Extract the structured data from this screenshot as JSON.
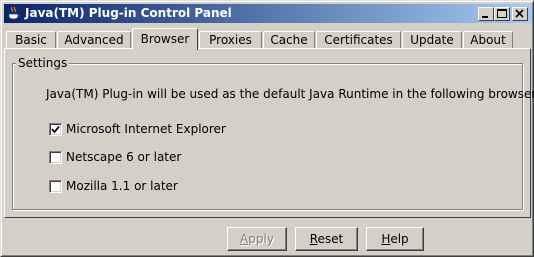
{
  "window": {
    "title": "Java(TM) Plug-in Control Panel",
    "icon": "java-coffee-cup-icon",
    "controls": [
      "minimize-icon",
      "maximize-icon",
      "close-icon"
    ]
  },
  "tabs": [
    {
      "label": "Basic",
      "active": false
    },
    {
      "label": "Advanced",
      "active": false
    },
    {
      "label": "Browser",
      "active": true
    },
    {
      "label": "Proxies",
      "active": false
    },
    {
      "label": "Cache",
      "active": false
    },
    {
      "label": "Certificates",
      "active": false
    },
    {
      "label": "Update",
      "active": false
    },
    {
      "label": "About",
      "active": false
    }
  ],
  "settings": {
    "group_label": "Settings",
    "message": "Java(TM) Plug-in will be used as the default Java Runtime in the following browser(s):",
    "options": [
      {
        "label": "Microsoft Internet Explorer",
        "checked": true
      },
      {
        "label": "Netscape 6 or later",
        "checked": false
      },
      {
        "label": "Mozilla 1.1 or later",
        "checked": false
      }
    ]
  },
  "buttons": {
    "apply": {
      "first": "A",
      "rest": "pply",
      "enabled": false
    },
    "reset": {
      "first": "R",
      "rest": "eset",
      "enabled": true
    },
    "help": {
      "first": "H",
      "rest": "elp",
      "enabled": true
    }
  },
  "colors": {
    "title_start": "#0a246a",
    "title_end": "#a6caf0",
    "face": "#d4d0c8"
  }
}
